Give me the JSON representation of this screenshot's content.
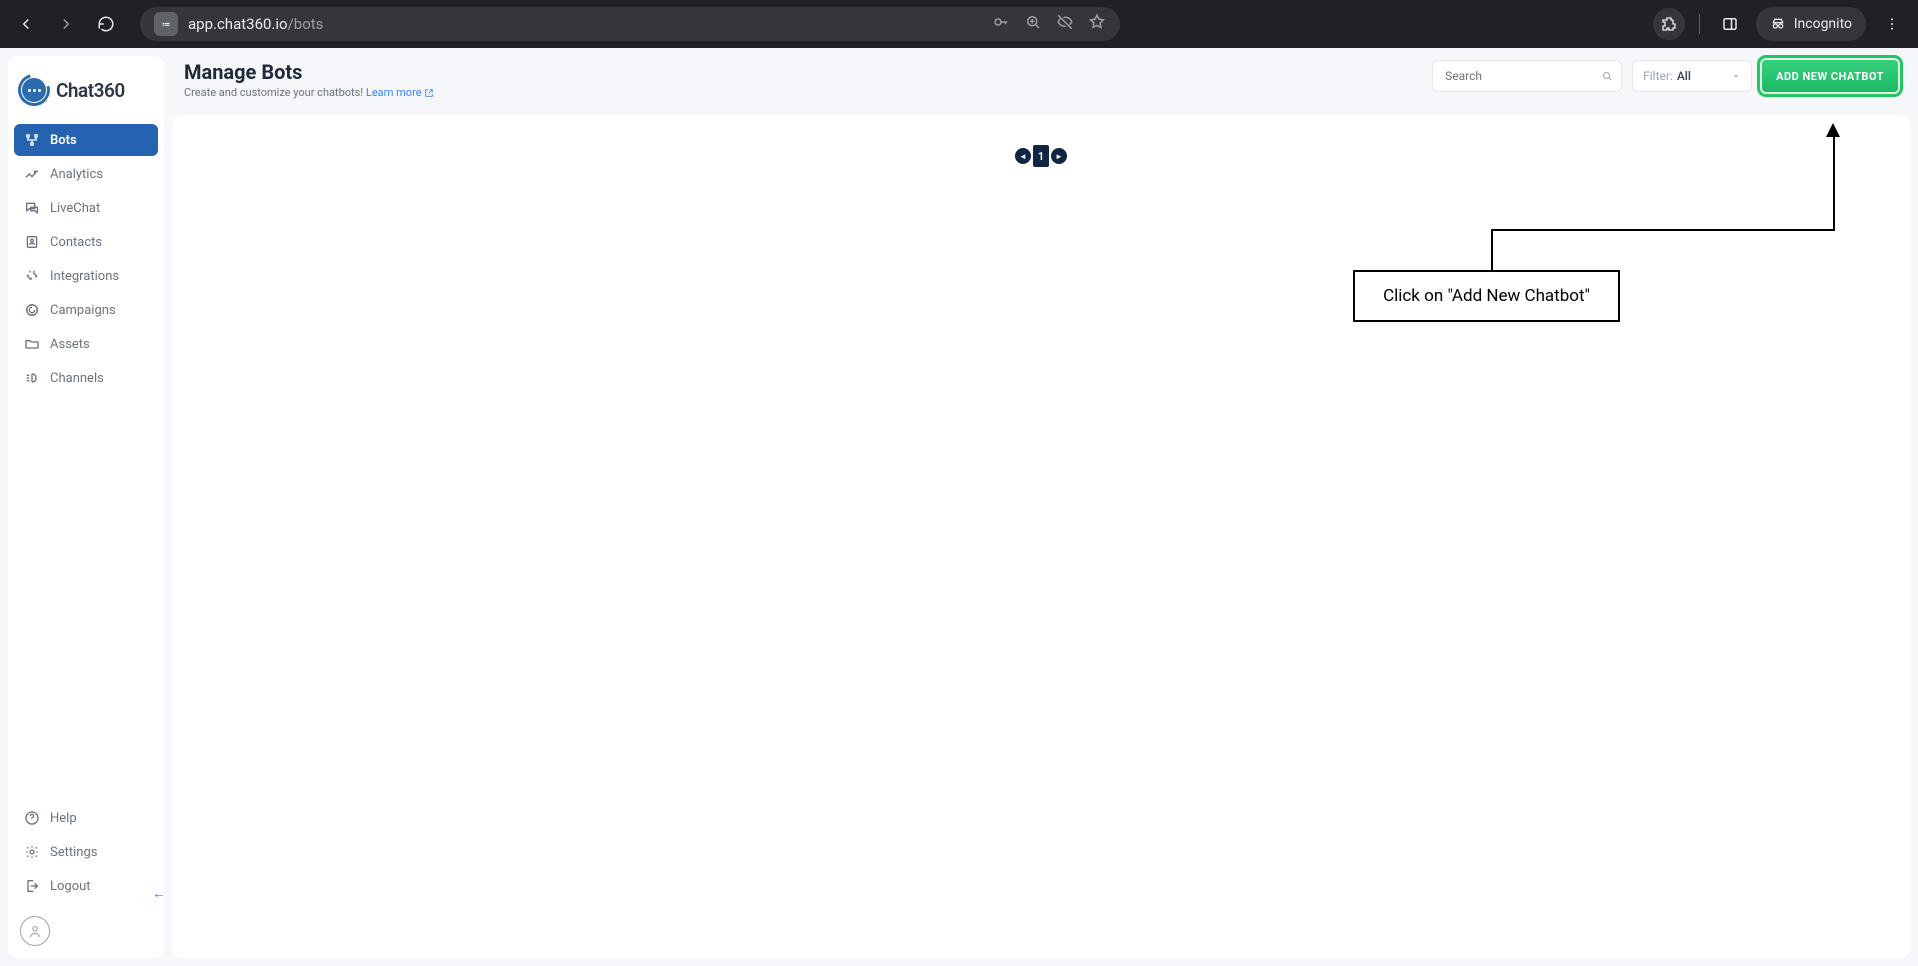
{
  "browser": {
    "url_host": "app.chat360.io",
    "url_path": "/bots",
    "incognito_label": "Incognito"
  },
  "logo_text": "Chat360",
  "sidebar": {
    "items": [
      {
        "label": "Bots"
      },
      {
        "label": "Analytics"
      },
      {
        "label": "LiveChat"
      },
      {
        "label": "Contacts"
      },
      {
        "label": "Integrations"
      },
      {
        "label": "Campaigns"
      },
      {
        "label": "Assets"
      },
      {
        "label": "Channels"
      }
    ],
    "bottom": [
      {
        "label": "Help"
      },
      {
        "label": "Settings"
      },
      {
        "label": "Logout"
      }
    ]
  },
  "header": {
    "title": "Manage Bots",
    "subtitle_prefix": "Create and customize your chatbots! ",
    "learn_more": "Learn more",
    "search_placeholder": "Search",
    "filter_label": "Filter:",
    "filter_value": "All",
    "add_button": "ADD NEW CHATBOT"
  },
  "pagination": {
    "page": "1"
  },
  "callout": {
    "text": "Click on \"Add New Chatbot\""
  }
}
